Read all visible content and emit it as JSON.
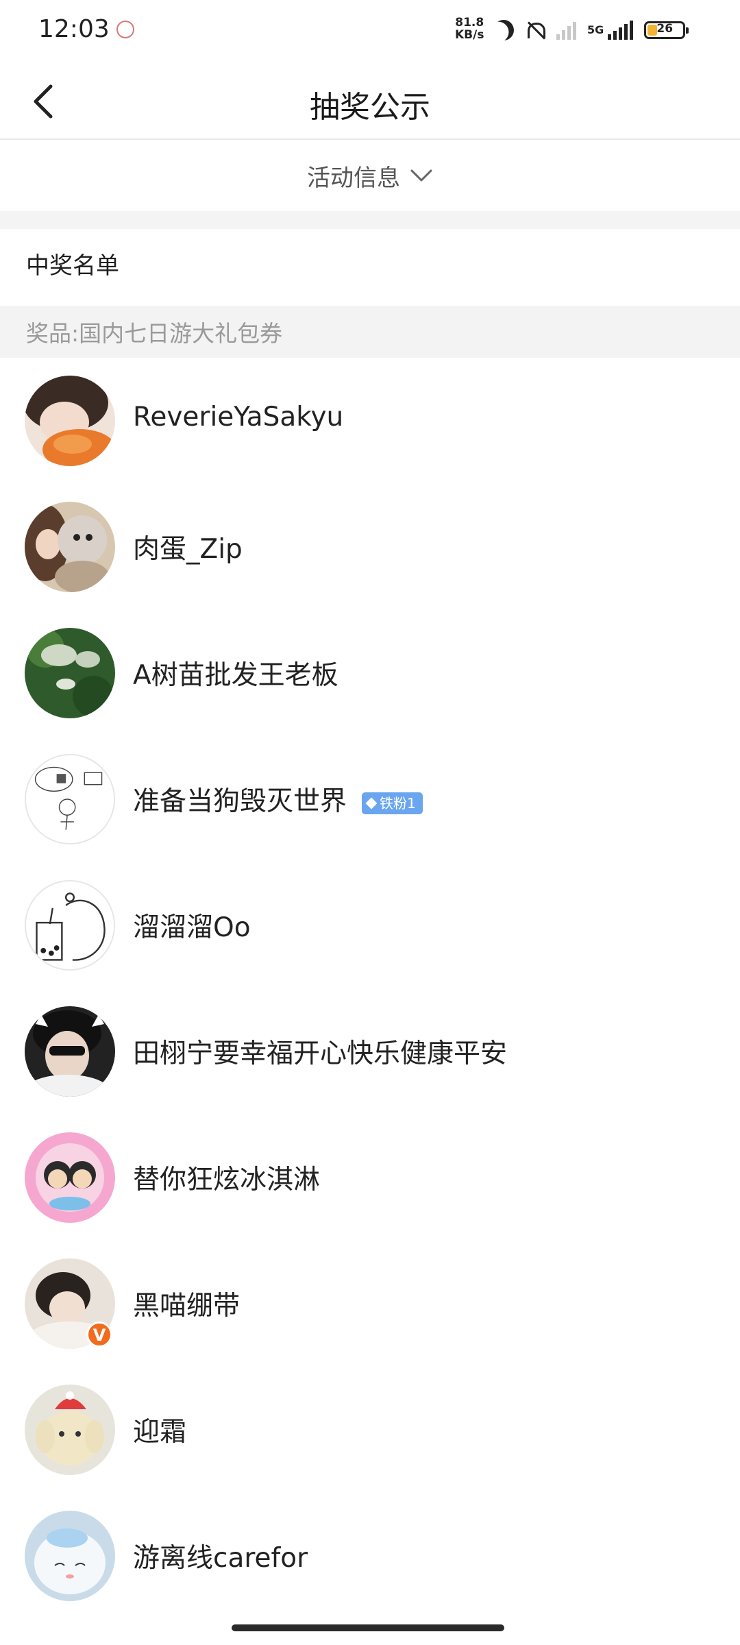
{
  "status_bar": {
    "time": "12:03",
    "net_speed_value": "81.8",
    "net_speed_unit": "KB/s",
    "network_type": "5G",
    "battery_level": "26",
    "icons": [
      "notification-icon",
      "moon-icon",
      "mute-icon",
      "signal-weak-icon",
      "signal-icon",
      "battery-icon"
    ]
  },
  "header": {
    "title": "抽奖公示",
    "back_icon": "chevron-left-icon"
  },
  "activity": {
    "label": "活动信息",
    "icon": "chevron-down-icon"
  },
  "winners_section": {
    "title": "中奖名单",
    "prize_label": "奖品:国内七日游大礼包券"
  },
  "winners": [
    {
      "name": "ReverieYaSakyu"
    },
    {
      "name": "肉蛋_Zip"
    },
    {
      "name": "A树苗批发王老板"
    },
    {
      "name": "准备当狗毁灭世界",
      "badge": "铁粉1"
    },
    {
      "name": "溜溜溜Oo"
    },
    {
      "name": "田栩宁要幸福开心快乐健康平安"
    },
    {
      "name": "替你狂炫冰淇淋"
    },
    {
      "name": "黑喵绷带",
      "verified": "V"
    },
    {
      "name": "迎霜"
    },
    {
      "name": "游离线carefor"
    }
  ],
  "colors": {
    "fan_badge": "#6aa6ef",
    "verified": "#f26b1d",
    "band": "#f3f3f3"
  }
}
